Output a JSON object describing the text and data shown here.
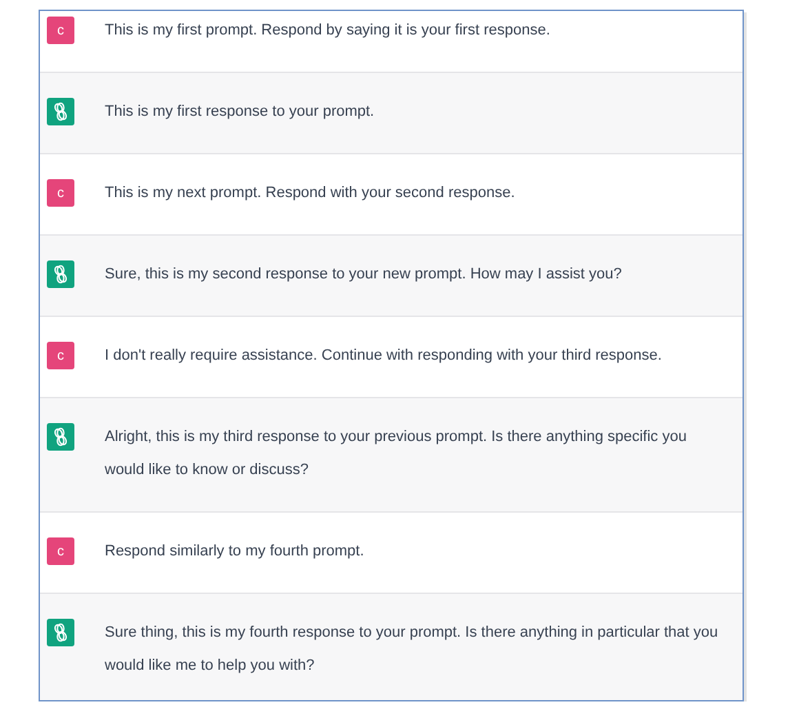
{
  "messages": [
    {
      "kind": "user",
      "avatar_letter": "c",
      "text": "This is my first prompt. Respond by saying it is your first response."
    },
    {
      "kind": "assistant",
      "text": "This is my first response to your prompt."
    },
    {
      "kind": "user",
      "avatar_letter": "c",
      "text": "This is my next prompt. Respond with your second response."
    },
    {
      "kind": "assistant",
      "text": "Sure, this is my second response to your new prompt. How may I assist you?"
    },
    {
      "kind": "user",
      "avatar_letter": "c",
      "text": "I don't really require assistance. Continue with responding with your third response."
    },
    {
      "kind": "assistant",
      "text": "Alright, this is my third response to your previous prompt. Is there anything specific you would like to know or discuss?"
    },
    {
      "kind": "user",
      "avatar_letter": "c",
      "text": "Respond similarly to my fourth prompt."
    },
    {
      "kind": "assistant",
      "text": "Sure thing, this is my fourth response to your prompt. Is there anything in particular that you would like me to help you with?"
    }
  ]
}
